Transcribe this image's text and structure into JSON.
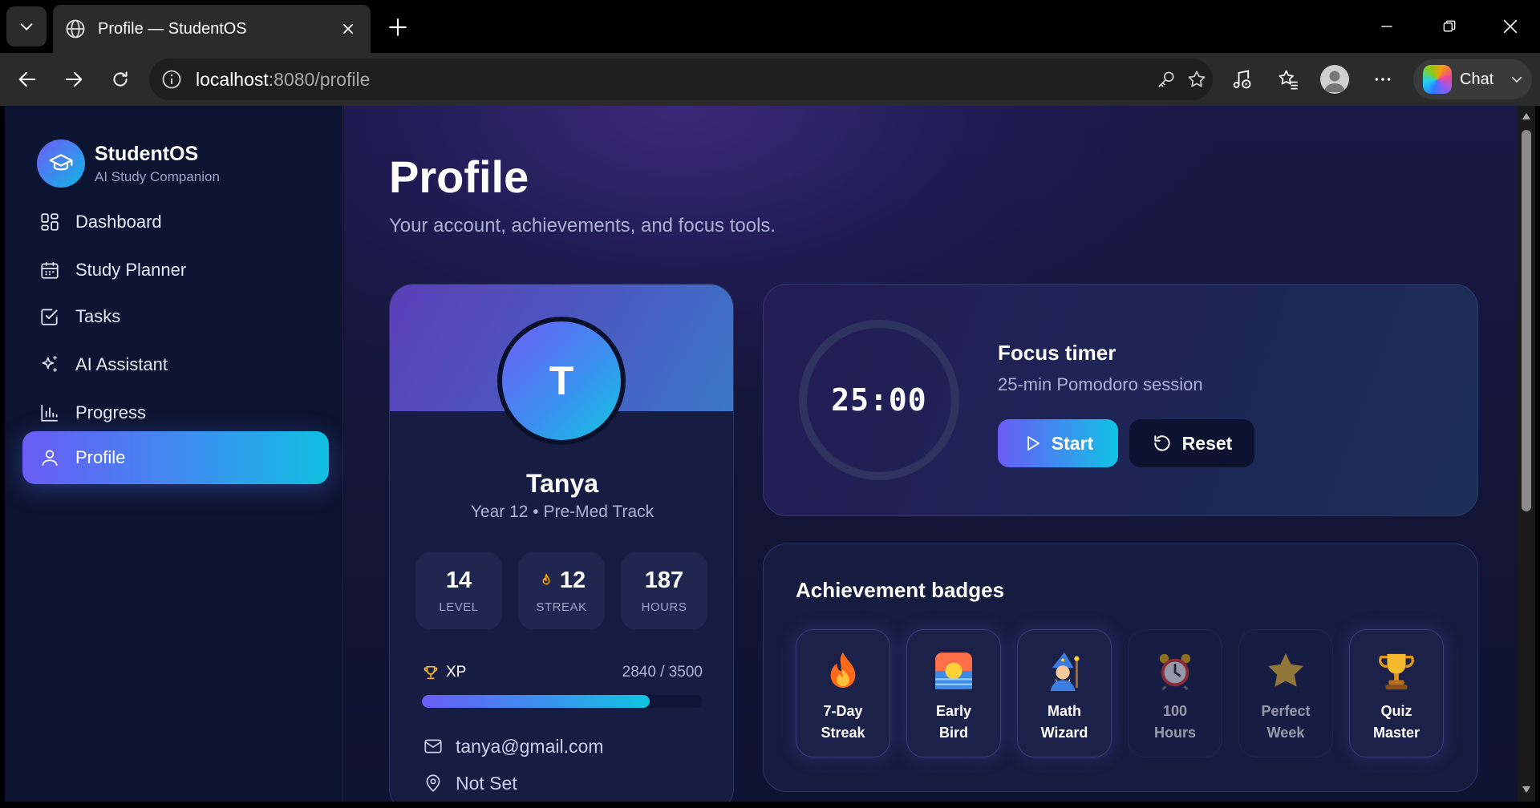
{
  "browser": {
    "tab_title": "Profile — StudentOS",
    "url_host": "localhost",
    "url_path": ":8080/profile",
    "chat_label": "Chat"
  },
  "sidebar": {
    "brand_name": "StudentOS",
    "brand_sub": "AI Study Companion",
    "items": [
      {
        "label": "Dashboard",
        "icon": "dashboard-icon"
      },
      {
        "label": "Study Planner",
        "icon": "calendar-icon"
      },
      {
        "label": "Tasks",
        "icon": "checkbox-icon"
      },
      {
        "label": "AI Assistant",
        "icon": "sparkles-icon"
      },
      {
        "label": "Progress",
        "icon": "bar-chart-icon"
      },
      {
        "label": "Profile",
        "icon": "user-icon",
        "active": true
      }
    ]
  },
  "page": {
    "title": "Profile",
    "subtitle": "Your account, achievements, and focus tools."
  },
  "profile": {
    "initial": "T",
    "name": "Tanya",
    "meta": "Year 12 • Pre-Med Track",
    "stats": [
      {
        "value": "14",
        "caption": "LEVEL"
      },
      {
        "value": "12",
        "caption": "STREAK",
        "icon": "flame-icon"
      },
      {
        "value": "187",
        "caption": "HOURS"
      }
    ],
    "xp_label": "XP",
    "xp_text": "2840 / 3500",
    "xp_fraction": 0.811,
    "email": "tanya@gmail.com",
    "location": "Not Set"
  },
  "timer": {
    "time": "25:00",
    "title": "Focus timer",
    "subtitle": "25-min Pomodoro session",
    "start_label": "Start",
    "reset_label": "Reset"
  },
  "badges": {
    "title": "Achievement badges",
    "items": [
      {
        "label": "7-Day\nStreak",
        "icon": "fire-icon",
        "locked": false
      },
      {
        "label": "Early\nBird",
        "icon": "sunrise-icon",
        "locked": false
      },
      {
        "label": "Math\nWizard",
        "icon": "wizard-icon",
        "locked": false
      },
      {
        "label": "100\nHours",
        "icon": "alarm-clock-icon",
        "locked": true
      },
      {
        "label": "Perfect\nWeek",
        "icon": "star-icon",
        "locked": true
      },
      {
        "label": "Quiz\nMaster",
        "icon": "trophy-icon",
        "locked": false
      }
    ]
  },
  "colors": {
    "accent_start": "#6a5cf4",
    "accent_mid": "#3d8ef0",
    "accent_end": "#10c4e2",
    "sidebar_bg": "#0d1431"
  }
}
